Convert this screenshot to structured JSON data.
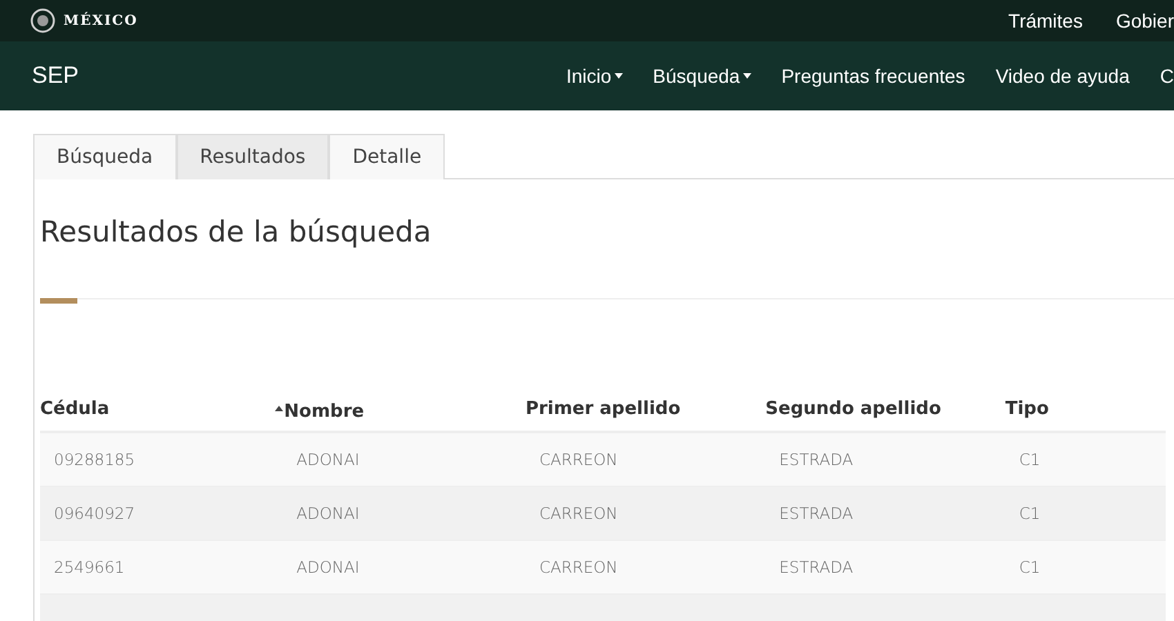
{
  "header": {
    "logo_text": "MÉXICO",
    "links": [
      "Trámites",
      "Gobier"
    ]
  },
  "nav": {
    "brand": "SEP",
    "items": [
      {
        "label": "Inicio",
        "dropdown": true
      },
      {
        "label": "Búsqueda",
        "dropdown": true
      },
      {
        "label": "Preguntas frecuentes",
        "dropdown": false
      },
      {
        "label": "Video de ayuda",
        "dropdown": false
      },
      {
        "label": "C",
        "dropdown": false
      }
    ]
  },
  "tabs": [
    {
      "label": "Búsqueda",
      "selected": false
    },
    {
      "label": "Resultados",
      "selected": true
    },
    {
      "label": "Detalle",
      "selected": false
    }
  ],
  "results": {
    "title": "Resultados de la búsqueda",
    "columns": [
      {
        "label": "Cédula",
        "sorted": false
      },
      {
        "label": "Nombre",
        "sorted": true
      },
      {
        "label": "Primer apellido",
        "sorted": false
      },
      {
        "label": "Segundo apellido",
        "sorted": false
      },
      {
        "label": "Tipo",
        "sorted": false
      }
    ],
    "rows": [
      [
        "09288185",
        "ADONAI",
        "CARREON",
        "ESTRADA",
        "C1"
      ],
      [
        "09640927",
        "ADONAI",
        "CARREON",
        "ESTRADA",
        "C1"
      ],
      [
        "2549661",
        "ADONAI",
        "CARREON",
        "ESTRADA",
        "C1"
      ]
    ]
  }
}
